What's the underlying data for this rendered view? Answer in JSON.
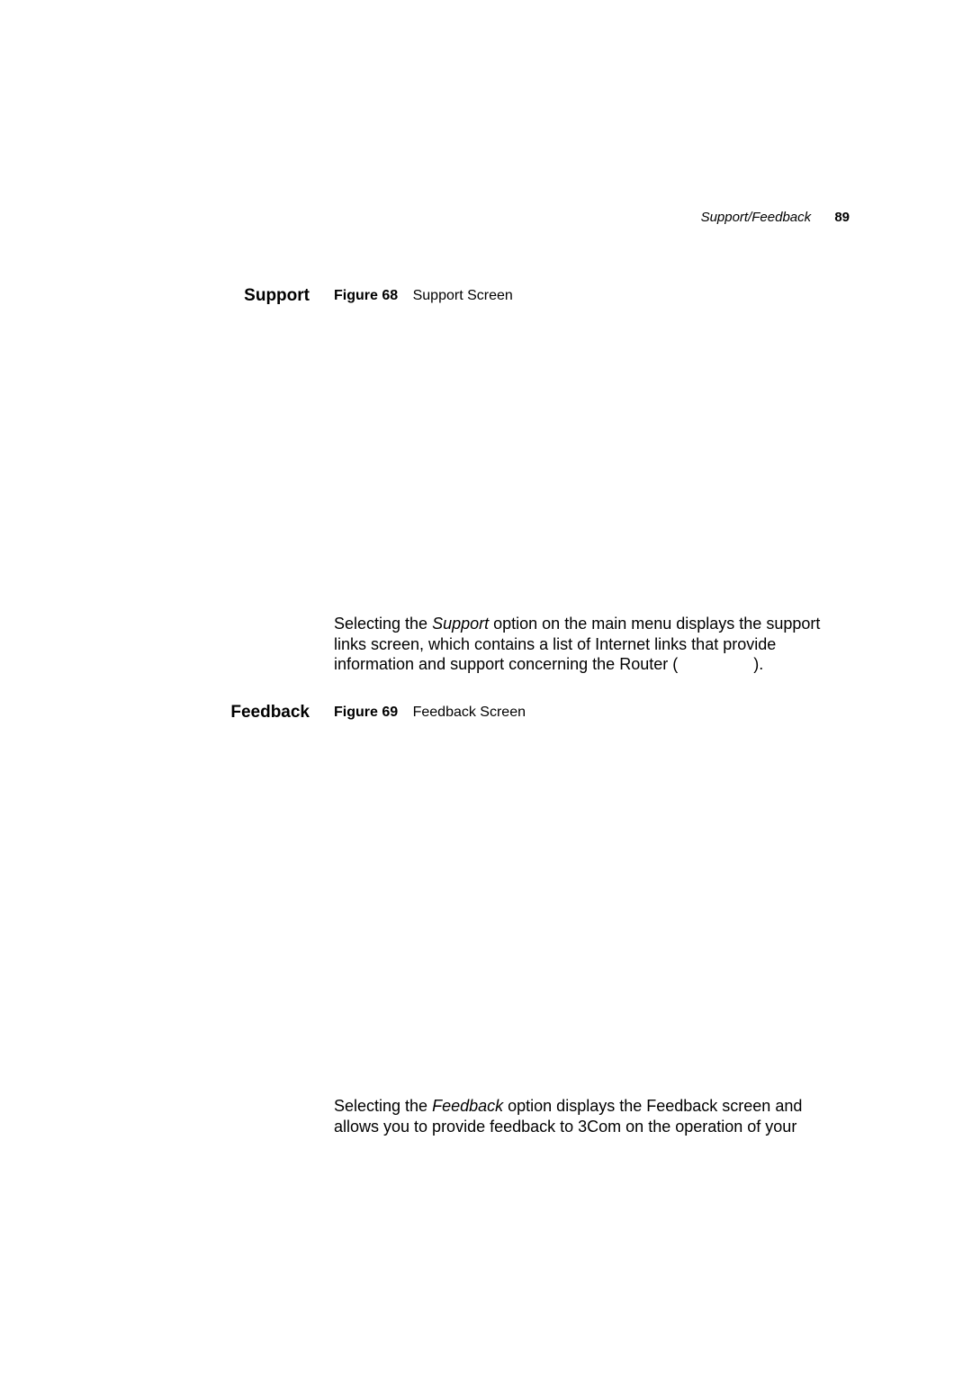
{
  "header": {
    "running_title": "Support/Feedback",
    "page_number": "89"
  },
  "sections": [
    {
      "label": "Support",
      "figure": {
        "number": "Figure 68",
        "caption": "Support Screen"
      },
      "paragraph": {
        "line1_pre": "Selecting the ",
        "line1_em": "Support",
        "line1_post": " option on the main menu displays the support",
        "line2": "links screen, which contains a list of Internet links that provide",
        "line3_pre": "information and support concerning the Router (",
        "line3_post": ")."
      }
    },
    {
      "label": "Feedback",
      "figure": {
        "number": "Figure 69",
        "caption": "Feedback Screen"
      },
      "paragraph": {
        "line1_pre": "Selecting the ",
        "line1_em": "Feedback",
        "line1_post": " option displays the Feedback screen and",
        "line2": "allows you to provide feedback to 3Com on the operation of your"
      }
    }
  ]
}
